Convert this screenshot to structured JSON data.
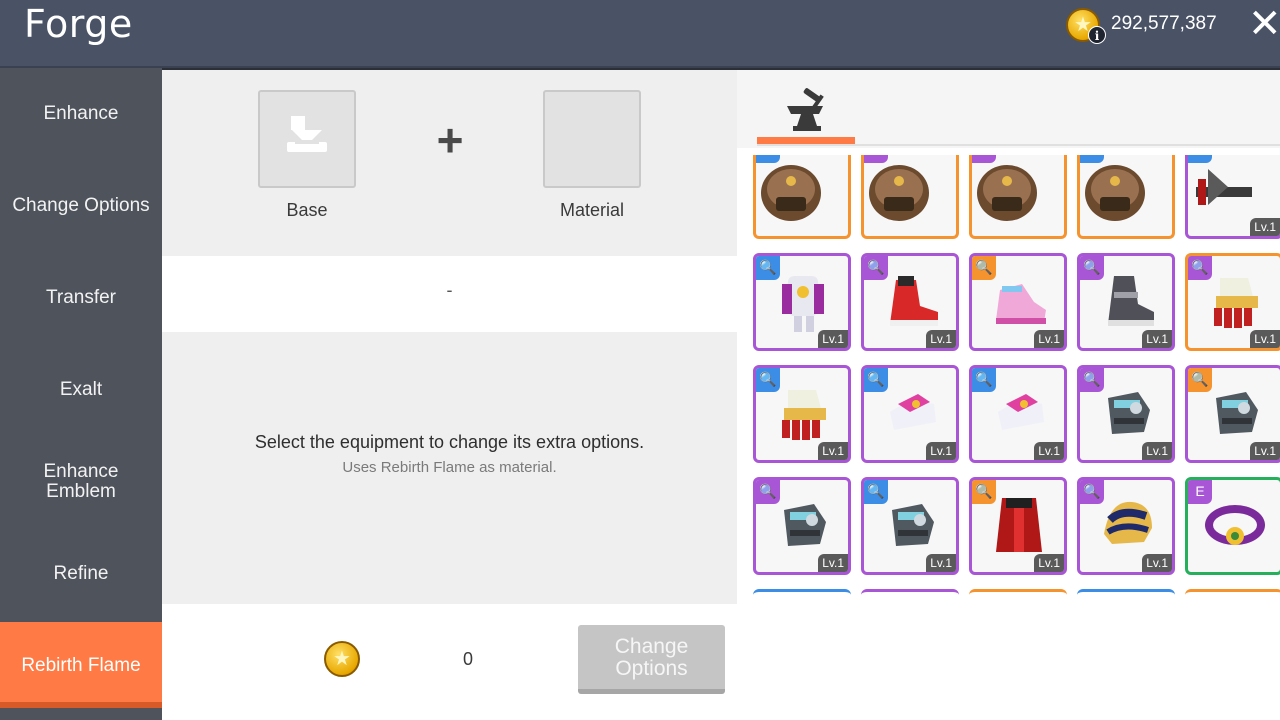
{
  "header": {
    "title": "Forge",
    "currency_value": "292,577,387",
    "currency_icon": "gold-coin-icon",
    "close_label": "✕"
  },
  "sidebar": {
    "items": [
      {
        "label": "Enhance",
        "active": false
      },
      {
        "label": "Change Options",
        "active": false
      },
      {
        "label": "Transfer",
        "active": false
      },
      {
        "label": "Exalt",
        "active": false
      },
      {
        "label": "Enhance Emblem",
        "active": false
      },
      {
        "label": "Refine",
        "active": false
      },
      {
        "label": "Rebirth Flame",
        "active": true
      }
    ]
  },
  "forge_panel": {
    "base_label": "Base",
    "material_label": "Material",
    "result_text": "-",
    "message_main": "Select the equipment to change its extra options.",
    "message_sub": "Uses Rebirth Flame as material.",
    "cost_value": "0",
    "action_button": "Change Options"
  },
  "inventory": {
    "tab_icon": "anvil-hammer-icon",
    "items": [
      {
        "art": "helmet-brown",
        "rarity": "orange",
        "badge": "blue",
        "badge_text": "",
        "level": ""
      },
      {
        "art": "helmet-brown",
        "rarity": "orange",
        "badge": "purple",
        "badge_text": "",
        "level": ""
      },
      {
        "art": "helmet-brown",
        "rarity": "orange",
        "badge": "purple",
        "badge_text": "",
        "level": ""
      },
      {
        "art": "helmet-brown",
        "rarity": "orange",
        "badge": "blue",
        "badge_text": "",
        "level": ""
      },
      {
        "art": "weapon-dark",
        "rarity": "purple",
        "badge": "blue",
        "badge_text": "",
        "level": "Lv.1"
      },
      {
        "art": "armor-white",
        "rarity": "purple",
        "badge": "blue",
        "badge_text": "🔍",
        "level": "Lv.1"
      },
      {
        "art": "shoe-red",
        "rarity": "purple",
        "badge": "purple",
        "badge_text": "🔍",
        "level": "Lv.1"
      },
      {
        "art": "shoe-pink",
        "rarity": "purple",
        "badge": "orange",
        "badge_text": "🔍",
        "level": "Lv.1"
      },
      {
        "art": "shoe-gray",
        "rarity": "purple",
        "badge": "purple",
        "badge_text": "🔍",
        "level": "Lv.1"
      },
      {
        "art": "glove-red",
        "rarity": "orange",
        "badge": "purple",
        "badge_text": "🔍",
        "level": "Lv.1"
      },
      {
        "art": "glove-red",
        "rarity": "purple",
        "badge": "blue",
        "badge_text": "🔍",
        "level": "Lv.1"
      },
      {
        "art": "glove-pink",
        "rarity": "purple",
        "badge": "blue",
        "badge_text": "🔍",
        "level": "Lv.1"
      },
      {
        "art": "glove-pink",
        "rarity": "purple",
        "badge": "blue",
        "badge_text": "🔍",
        "level": "Lv.1"
      },
      {
        "art": "glove-steel",
        "rarity": "purple",
        "badge": "purple",
        "badge_text": "🔍",
        "level": "Lv.1"
      },
      {
        "art": "glove-steel",
        "rarity": "purple",
        "badge": "orange",
        "badge_text": "🔍",
        "level": "Lv.1"
      },
      {
        "art": "glove-steel",
        "rarity": "purple",
        "badge": "purple",
        "badge_text": "🔍",
        "level": "Lv.1"
      },
      {
        "art": "glove-steel",
        "rarity": "purple",
        "badge": "blue",
        "badge_text": "🔍",
        "level": "Lv.1"
      },
      {
        "art": "cape-red",
        "rarity": "purple",
        "badge": "orange",
        "badge_text": "🔍",
        "level": "Lv.1"
      },
      {
        "art": "shoulder-gold",
        "rarity": "purple",
        "badge": "purple",
        "badge_text": "🔍",
        "level": "Lv.1"
      },
      {
        "art": "belt-purple",
        "rarity": "green",
        "badge": "purple",
        "badge_text": "E",
        "level": ""
      }
    ]
  },
  "colors": {
    "accent": "#ff7a45",
    "epic": "#a855d6",
    "unique": "#f5932f",
    "legendary": "#26b05c"
  }
}
